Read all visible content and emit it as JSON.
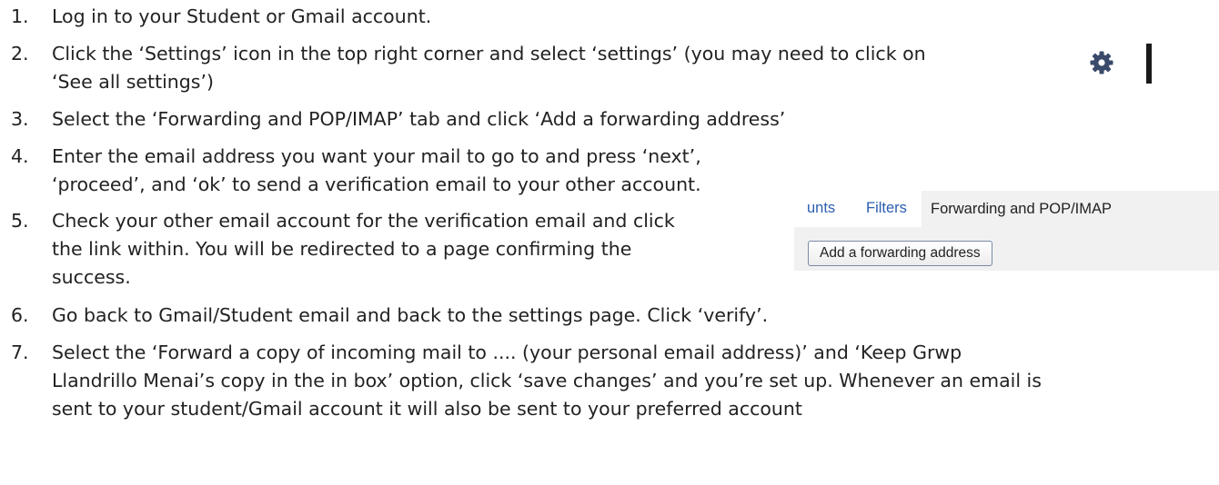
{
  "steps": [
    {
      "num": "1.",
      "lines": [
        "Log in to your Student or Gmail account."
      ]
    },
    {
      "num": "2.",
      "lines": [
        "Click the ‘Settings’ icon in the top right corner and select ‘settings’ (you may need to click on",
        "‘See all settings’)"
      ]
    },
    {
      "num": "3.",
      "lines": [
        "Select the ‘Forwarding and POP/IMAP’ tab and click ‘Add a forwarding address’"
      ]
    },
    {
      "num": "4.",
      "lines": [
        "Enter the email address you want your mail to go to and press ‘next’,",
        "‘proceed’, and ‘ok’ to send a verification email to your other account."
      ]
    },
    {
      "num": "5.",
      "lines": [
        "Check your other email account for the verification email and click",
        "the link within. You will be redirected to a page confirming the",
        "success."
      ]
    },
    {
      "num": "6.",
      "lines": [
        "Go back to Gmail/Student email and back to the settings page. Click ‘verify’."
      ]
    },
    {
      "num": "7.",
      "lines": [
        "Select the ‘Forward a copy of incoming mail to .... (your personal email address)’ and ‘Keep Grwp",
        "Llandrillo Menai’s copy in the in box’ option, click ‘save changes’ and you’re set up. Whenever an email is",
        "sent to your student/Gmail account it will also be sent to your preferred account"
      ]
    }
  ],
  "settings_icon": {
    "icon": "gear-icon",
    "color": "#3a4a6a"
  },
  "forwarding_inset": {
    "tabs": {
      "accounts": "unts",
      "filters": "Filters",
      "forwarding": "Forwarding and POP/IMAP"
    },
    "add_button_label": "Add a forwarding address",
    "link_color": "#2a5db0"
  }
}
